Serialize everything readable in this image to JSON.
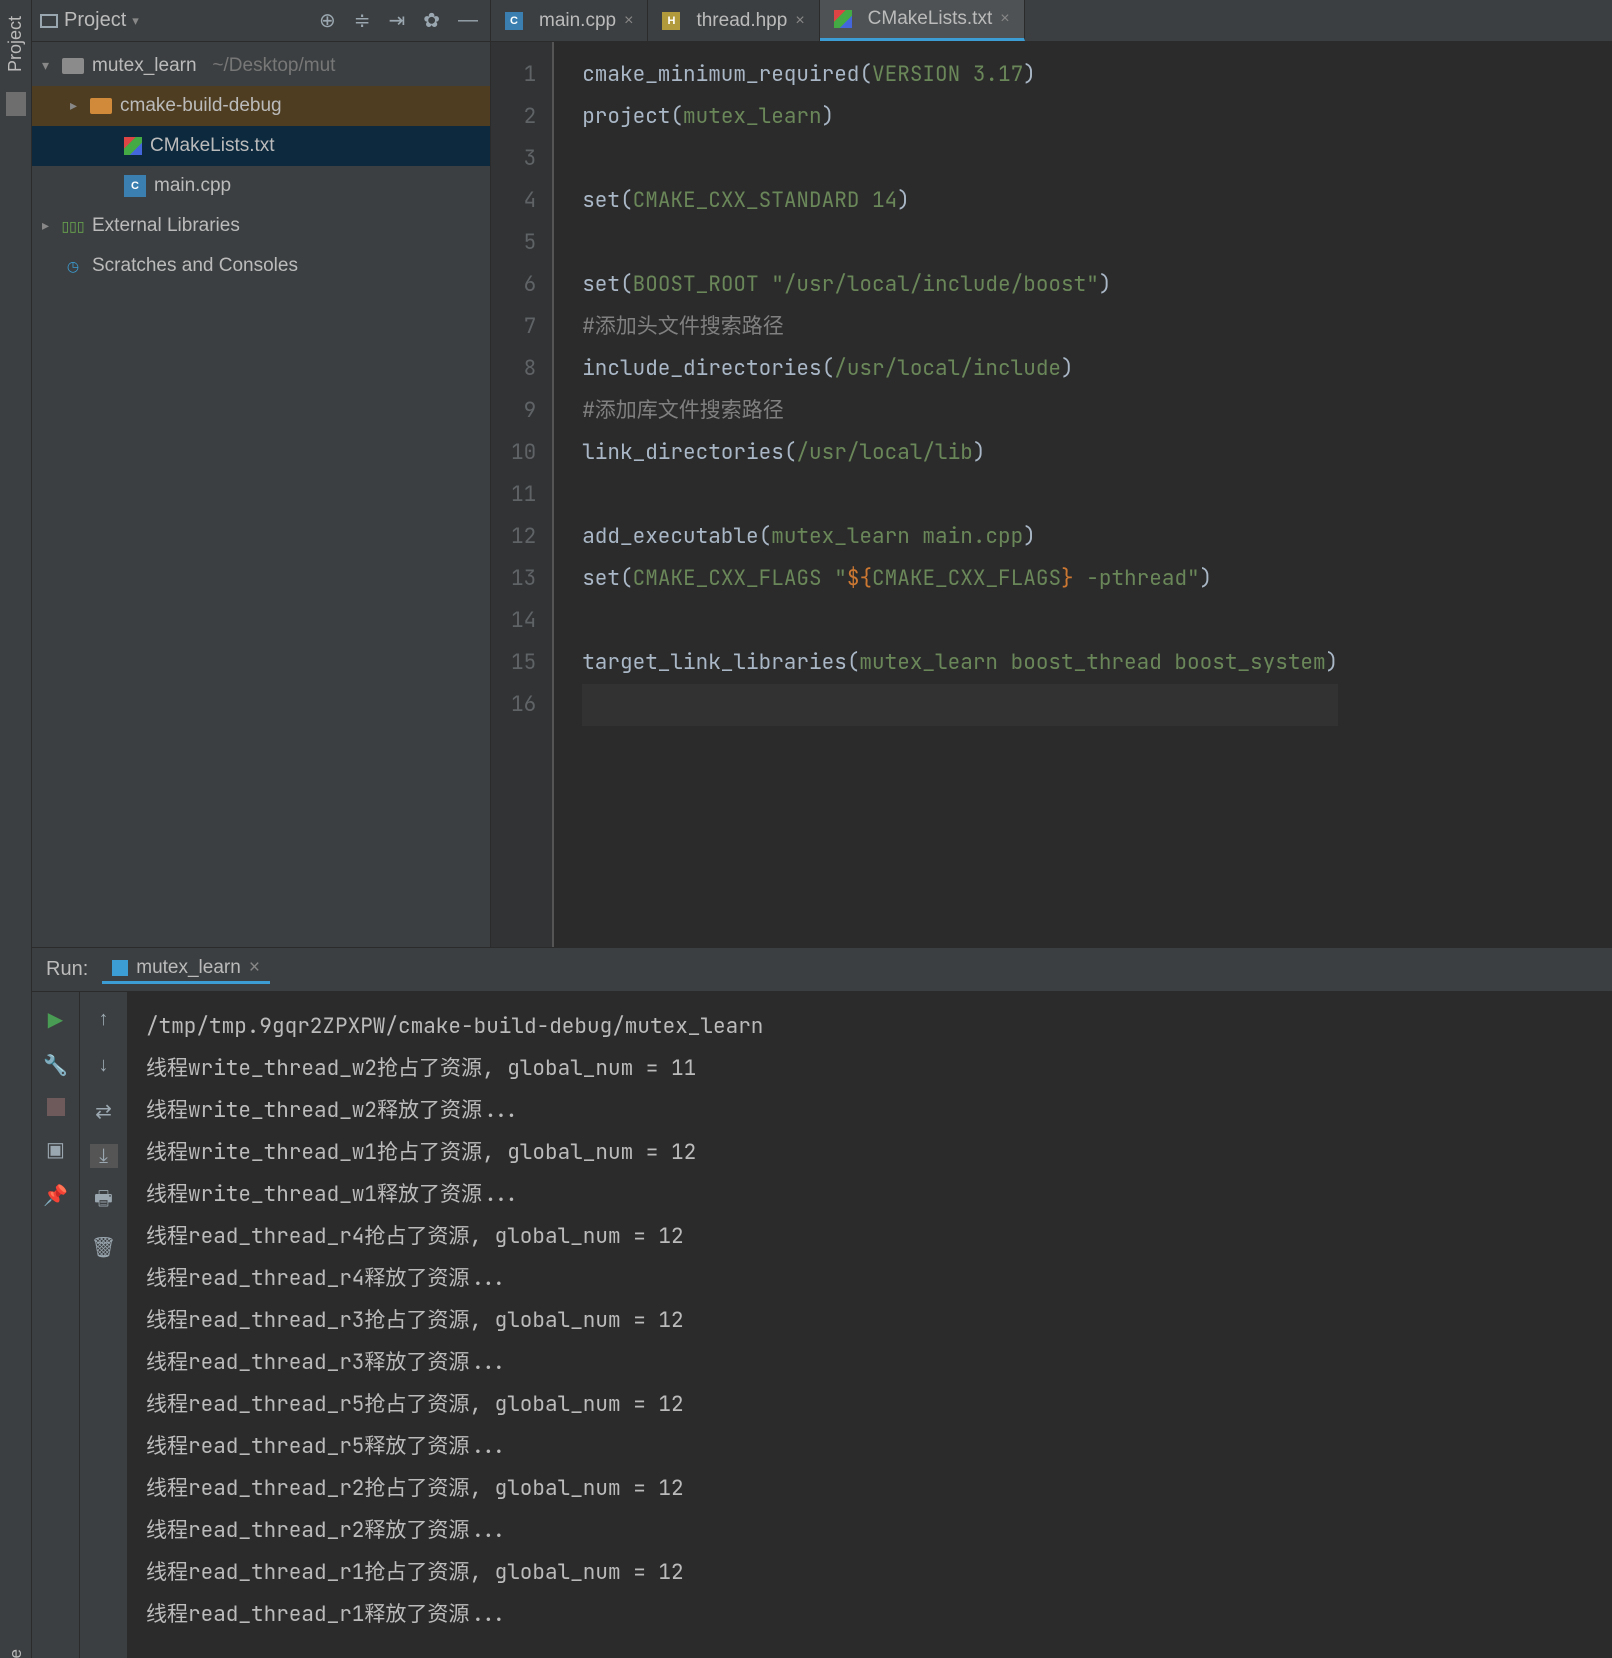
{
  "left_strip": {
    "project_label": "Project"
  },
  "sidebar": {
    "title": "Project",
    "root": {
      "name": "mutex_learn",
      "path": "~/Desktop/mut"
    },
    "items": [
      {
        "label": "cmake-build-debug"
      },
      {
        "label": "CMakeLists.txt"
      },
      {
        "label": "main.cpp"
      }
    ],
    "external": "External Libraries",
    "scratches": "Scratches and Consoles"
  },
  "tabs": [
    {
      "label": "main.cpp"
    },
    {
      "label": "thread.hpp"
    },
    {
      "label": "CMakeLists.txt"
    }
  ],
  "code": {
    "lines": [
      {
        "n": 1,
        "html": "<span class='fn'>cmake_minimum_required</span>(<span class='id'>VERSION 3.17</span>)"
      },
      {
        "n": 2,
        "html": "<span class='fn'>project</span>(<span class='id'>mutex_learn</span>)"
      },
      {
        "n": 3,
        "html": ""
      },
      {
        "n": 4,
        "html": "<span class='fn'>set</span>(<span class='id'>CMAKE_CXX_STANDARD 14</span>)"
      },
      {
        "n": 5,
        "html": ""
      },
      {
        "n": 6,
        "html": "<span class='fn'>set</span>(<span class='id'>BOOST_ROOT </span><span class='str'>\"/usr/local/include/boost\"</span>)"
      },
      {
        "n": 7,
        "html": "<span class='cmt'>#添加头文件搜索路径</span>"
      },
      {
        "n": 8,
        "html": "<span class='fn'>include_directories</span>(<span class='id'>/usr/local/include</span>)"
      },
      {
        "n": 9,
        "html": "<span class='cmt'>#添加库文件搜索路径</span>"
      },
      {
        "n": 10,
        "html": "<span class='fn'>link_directories</span>(<span class='id'>/usr/local/lib</span>)"
      },
      {
        "n": 11,
        "html": ""
      },
      {
        "n": 12,
        "html": "<span class='fn'>add_executable</span>(<span class='id'>mutex_learn main.cpp</span>)"
      },
      {
        "n": 13,
        "html": "<span class='fn'>set</span>(<span class='id'>CMAKE_CXX_FLAGS </span><span class='str'>\"</span><span class='mac'>${</span><span class='id'>CMAKE_CXX_FLAGS</span><span class='mac'>}</span><span class='str'> -pthread\"</span>)"
      },
      {
        "n": 14,
        "html": ""
      },
      {
        "n": 15,
        "html": "<span class='fn'>target_link_libraries</span>(<span class='id'>mutex_learn boost_thread boost_system</span>)"
      },
      {
        "n": 16,
        "html": ""
      }
    ],
    "current_line": 16
  },
  "run": {
    "label": "Run:",
    "config": "mutex_learn",
    "output": [
      "/tmp/tmp.9gqr2ZPXPW/cmake-build-debug/mutex_learn",
      "线程write_thread_w2抢占了资源, global_num = 11",
      "线程write_thread_w2释放了资源...",
      "线程write_thread_w1抢占了资源, global_num = 12",
      "线程write_thread_w1释放了资源...",
      "线程read_thread_r4抢占了资源, global_num = 12",
      "线程read_thread_r4释放了资源...",
      "线程read_thread_r3抢占了资源, global_num = 12",
      "线程read_thread_r3释放了资源...",
      "线程read_thread_r5抢占了资源, global_num = 12",
      "线程read_thread_r5释放了资源...",
      "线程read_thread_r2抢占了资源, global_num = 12",
      "线程read_thread_r2释放了资源...",
      "线程read_thread_r1抢占了资源, global_num = 12",
      "线程read_thread_r1释放了资源..."
    ]
  },
  "bottom_strip": {
    "structure_label": "e"
  }
}
